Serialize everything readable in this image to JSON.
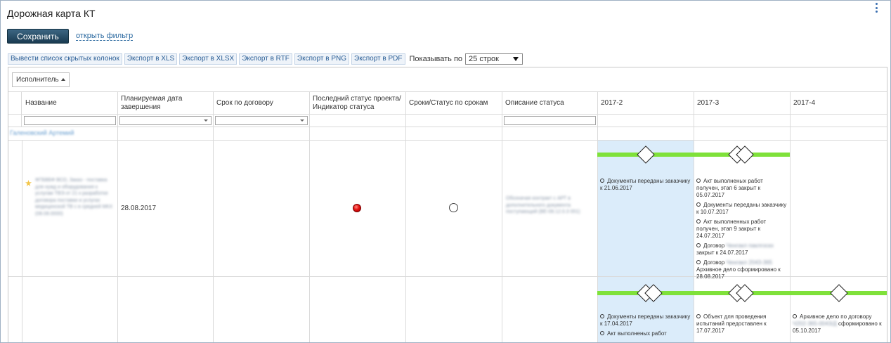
{
  "header": {
    "title": "Дорожная карта КТ"
  },
  "actions": {
    "save_label": "Сохранить",
    "filter_link": "открыть фильтр"
  },
  "toolbar": {
    "buttons": [
      "Вывести список скрытых колонок",
      "Экспорт в XLS",
      "Экспорт в XLSX",
      "Экспорт в RTF",
      "Экспорт в PNG",
      "Экспорт в PDF"
    ],
    "show_label": "Показывать по",
    "page_size": "25 строк"
  },
  "grid": {
    "group_by": "Исполнитель",
    "columns": [
      "Название",
      "Планируемая дата завершения",
      "Срок по договору",
      "Последний статус проекта/ Индикатор статуса",
      "Сроки/Статус по срокам",
      "Описание статуса",
      "2017-2",
      "2017-3",
      "2017-4"
    ],
    "group_label": "Галеновский Артемий",
    "rows": [
      {
        "name": "ФГБВБФ ВСО, Заказ - поставка для нужд и оборудования к услугам ТВЭ от 21 к разработке договора поставки и услугах медицинской ТВ с в средней МКХ (08.08.0000)",
        "planned_date": "28.08.2017",
        "status_description": "Обозначая контракт с АРТ в дополнительного документа поступающий (ВЕ-08.12.0.3 001)",
        "indicator_color": "#e51010",
        "milestones": {
          "2017-2": [
            "Документы переданы заказчику к 21.06.2017"
          ],
          "2017-3": [
            "Акт выполненых работ получен, этап 6 закрыт к 05.07.2017",
            "Документы переданы заказчику к 10.07.2017",
            "Акт выполненных работ получен, этап 9 закрыт к 24.07.2017",
            {
              "pre": "Договор",
              "hidden": "Ченгакл паклгоскх",
              "post": "закрыт к 24.07.2017"
            },
            {
              "pre": "Договор",
              "hidden": "Ченгакл 2043-365",
              "post": "Архивное дело сформировано к 28.08.2017"
            }
          ]
        }
      },
      {
        "milestones": {
          "2017-2": [
            "Документы переданы заказчику к 17.04.2017",
            "Акт выполненых работ"
          ],
          "2017-3": [
            "Объект для проведения испытаний предоставлен к 17.07.2017"
          ],
          "2017-4": [
            {
              "pre": "Архивное дело по договору",
              "hidden": "Ч202-365-0043/Д",
              "post": "сформировано к 05.10.2017"
            }
          ]
        }
      }
    ]
  }
}
